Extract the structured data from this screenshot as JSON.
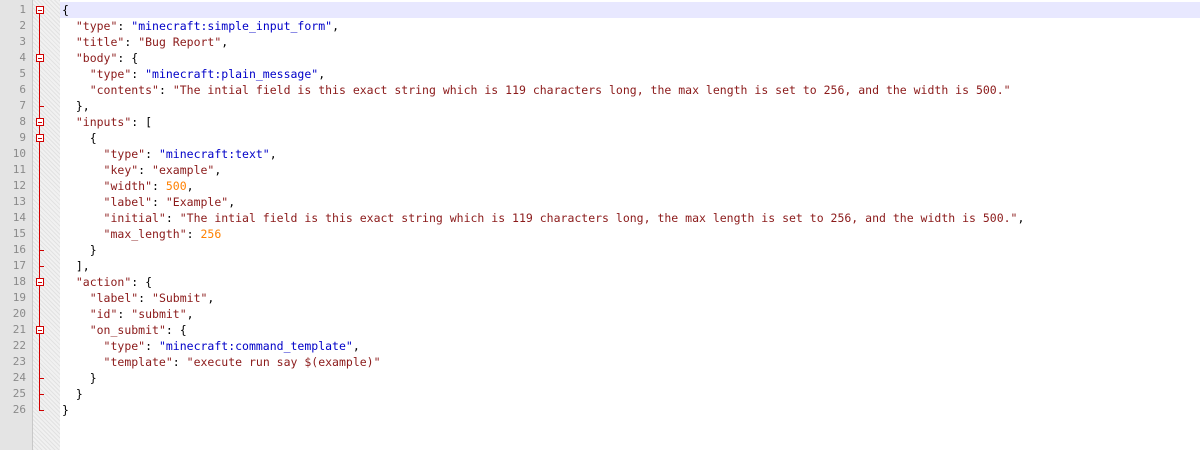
{
  "editor": {
    "lines": [
      {
        "n": "1",
        "indent": 0,
        "tokens": [
          [
            "p",
            "{"
          ]
        ]
      },
      {
        "n": "2",
        "indent": 2,
        "tokens": [
          [
            "k",
            "\"type\""
          ],
          [
            "p",
            ": "
          ],
          [
            "u",
            "\"minecraft:simple_input_form\""
          ],
          [
            "p",
            ","
          ]
        ]
      },
      {
        "n": "3",
        "indent": 2,
        "tokens": [
          [
            "k",
            "\"title\""
          ],
          [
            "p",
            ": "
          ],
          [
            "s",
            "\"Bug Report\""
          ],
          [
            "p",
            ","
          ]
        ]
      },
      {
        "n": "4",
        "indent": 2,
        "tokens": [
          [
            "k",
            "\"body\""
          ],
          [
            "p",
            ": {"
          ]
        ]
      },
      {
        "n": "5",
        "indent": 4,
        "tokens": [
          [
            "k",
            "\"type\""
          ],
          [
            "p",
            ": "
          ],
          [
            "u",
            "\"minecraft:plain_message\""
          ],
          [
            "p",
            ","
          ]
        ]
      },
      {
        "n": "6",
        "indent": 4,
        "tokens": [
          [
            "k",
            "\"contents\""
          ],
          [
            "p",
            ": "
          ],
          [
            "s",
            "\"The intial field is this exact string which is 119 characters long, the max length is set to 256, and the width is 500.\""
          ]
        ]
      },
      {
        "n": "7",
        "indent": 2,
        "tokens": [
          [
            "p",
            "},"
          ]
        ]
      },
      {
        "n": "8",
        "indent": 2,
        "tokens": [
          [
            "k",
            "\"inputs\""
          ],
          [
            "p",
            ": ["
          ]
        ]
      },
      {
        "n": "9",
        "indent": 4,
        "tokens": [
          [
            "p",
            "{"
          ]
        ]
      },
      {
        "n": "10",
        "indent": 6,
        "tokens": [
          [
            "k",
            "\"type\""
          ],
          [
            "p",
            ": "
          ],
          [
            "u",
            "\"minecraft:text\""
          ],
          [
            "p",
            ","
          ]
        ]
      },
      {
        "n": "11",
        "indent": 6,
        "tokens": [
          [
            "k",
            "\"key\""
          ],
          [
            "p",
            ": "
          ],
          [
            "s",
            "\"example\""
          ],
          [
            "p",
            ","
          ]
        ]
      },
      {
        "n": "12",
        "indent": 6,
        "tokens": [
          [
            "k",
            "\"width\""
          ],
          [
            "p",
            ": "
          ],
          [
            "n",
            "500"
          ],
          [
            "p",
            ","
          ]
        ]
      },
      {
        "n": "13",
        "indent": 6,
        "tokens": [
          [
            "k",
            "\"label\""
          ],
          [
            "p",
            ": "
          ],
          [
            "s",
            "\"Example\""
          ],
          [
            "p",
            ","
          ]
        ]
      },
      {
        "n": "14",
        "indent": 6,
        "tokens": [
          [
            "k",
            "\"initial\""
          ],
          [
            "p",
            ": "
          ],
          [
            "s",
            "\"The intial field is this exact string which is 119 characters long, the max length is set to 256, and the width is 500.\""
          ],
          [
            "p",
            ","
          ]
        ]
      },
      {
        "n": "15",
        "indent": 6,
        "tokens": [
          [
            "k",
            "\"max_length\""
          ],
          [
            "p",
            ": "
          ],
          [
            "n",
            "256"
          ]
        ]
      },
      {
        "n": "16",
        "indent": 4,
        "tokens": [
          [
            "p",
            "}"
          ]
        ]
      },
      {
        "n": "17",
        "indent": 2,
        "tokens": [
          [
            "p",
            "],"
          ]
        ]
      },
      {
        "n": "18",
        "indent": 2,
        "tokens": [
          [
            "k",
            "\"action\""
          ],
          [
            "p",
            ": {"
          ]
        ]
      },
      {
        "n": "19",
        "indent": 4,
        "tokens": [
          [
            "k",
            "\"label\""
          ],
          [
            "p",
            ": "
          ],
          [
            "s",
            "\"Submit\""
          ],
          [
            "p",
            ","
          ]
        ]
      },
      {
        "n": "20",
        "indent": 4,
        "tokens": [
          [
            "k",
            "\"id\""
          ],
          [
            "p",
            ": "
          ],
          [
            "s",
            "\"submit\""
          ],
          [
            "p",
            ","
          ]
        ]
      },
      {
        "n": "21",
        "indent": 4,
        "tokens": [
          [
            "k",
            "\"on_submit\""
          ],
          [
            "p",
            ": {"
          ]
        ]
      },
      {
        "n": "22",
        "indent": 6,
        "tokens": [
          [
            "k",
            "\"type\""
          ],
          [
            "p",
            ": "
          ],
          [
            "u",
            "\"minecraft:command_template\""
          ],
          [
            "p",
            ","
          ]
        ]
      },
      {
        "n": "23",
        "indent": 6,
        "tokens": [
          [
            "k",
            "\"template\""
          ],
          [
            "p",
            ": "
          ],
          [
            "s",
            "\"execute run say $(example)\""
          ]
        ]
      },
      {
        "n": "24",
        "indent": 4,
        "tokens": [
          [
            "p",
            "}"
          ]
        ]
      },
      {
        "n": "25",
        "indent": 2,
        "tokens": [
          [
            "p",
            "}"
          ]
        ]
      },
      {
        "n": "26",
        "indent": 0,
        "tokens": [
          [
            "p",
            "}"
          ]
        ]
      }
    ],
    "colors": {
      "key": "#8b1a1a",
      "string": "#8b1a1a",
      "type_string": "#0000c8",
      "number": "#ff8000",
      "fold_marker": "#d00000",
      "current_line": "#e8e8ff"
    }
  }
}
